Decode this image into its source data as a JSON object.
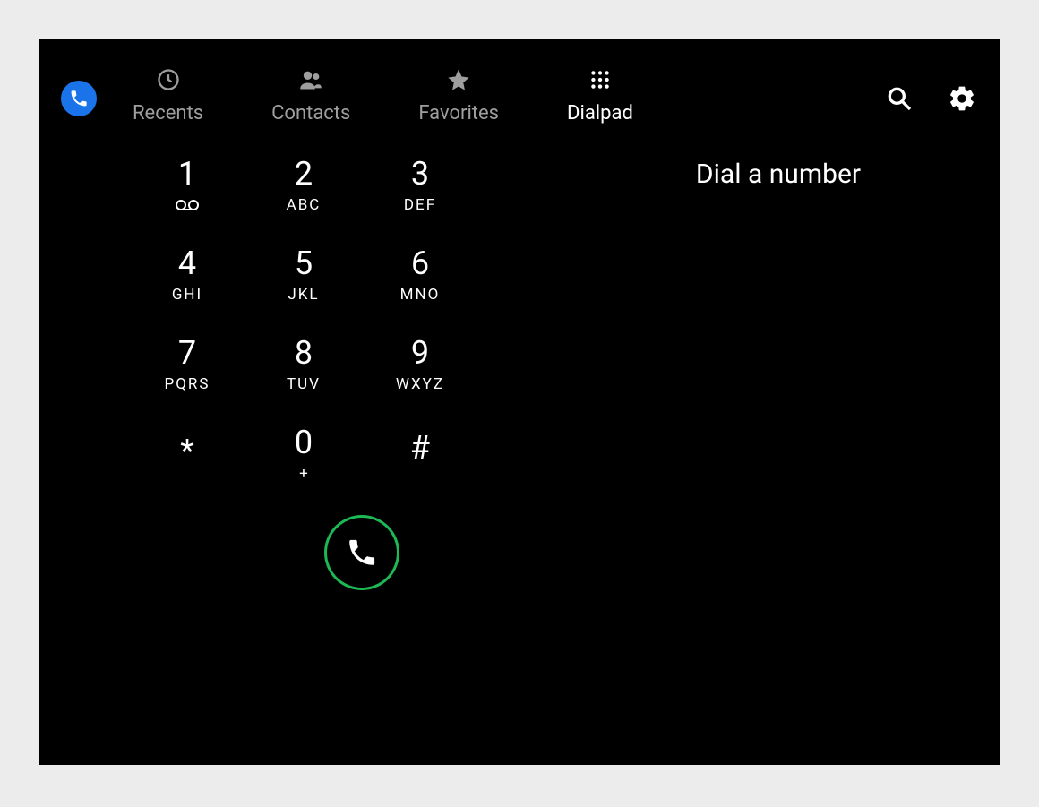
{
  "tabs": {
    "recents": "Recents",
    "contacts": "Contacts",
    "favorites": "Favorites",
    "dialpad": "Dialpad"
  },
  "display": {
    "placeholder": "Dial a number"
  },
  "keys": [
    {
      "main": "1",
      "sub_icon": "voicemail"
    },
    {
      "main": "2",
      "sub": "ABC"
    },
    {
      "main": "3",
      "sub": "DEF"
    },
    {
      "main": "4",
      "sub": "GHI"
    },
    {
      "main": "5",
      "sub": "JKL"
    },
    {
      "main": "6",
      "sub": "MNO"
    },
    {
      "main": "7",
      "sub": "PQRS"
    },
    {
      "main": "8",
      "sub": "TUV"
    },
    {
      "main": "9",
      "sub": "WXYZ"
    },
    {
      "main": "*",
      "sub": ""
    },
    {
      "main": "0",
      "sub": "+"
    },
    {
      "main": "#",
      "sub": ""
    }
  ],
  "colors": {
    "accent_blue": "#1a73e8",
    "call_green": "#1db954",
    "inactive_grey": "#9e9e9e"
  }
}
